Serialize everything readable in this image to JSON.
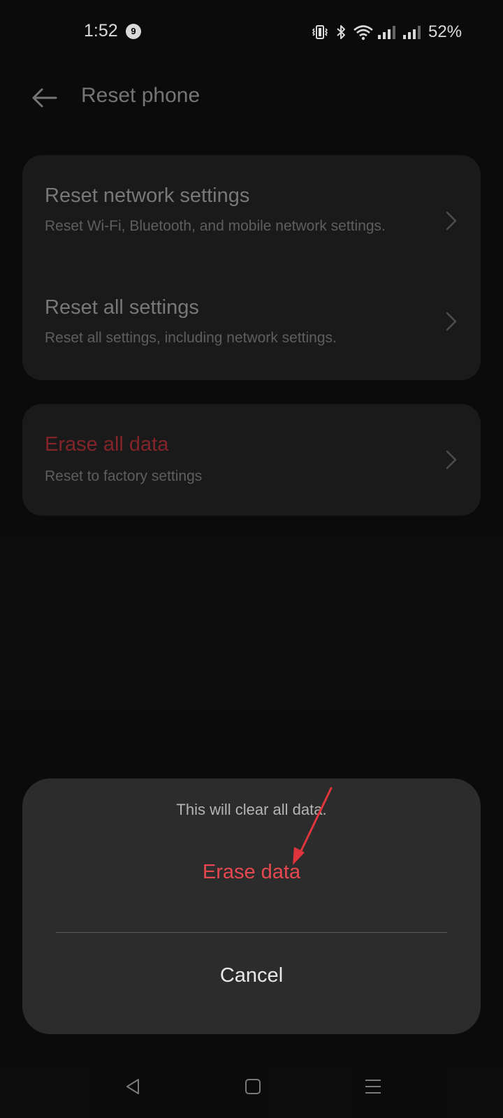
{
  "status_bar": {
    "time": "1:52",
    "notification_count": "9",
    "battery": "52%",
    "icons": [
      "vibrate-icon",
      "bluetooth-icon",
      "wifi-icon",
      "signal-1-icon",
      "signal-2-icon"
    ]
  },
  "header": {
    "title": "Reset phone",
    "back_icon": "arrow-left-icon"
  },
  "reset_group": {
    "items": [
      {
        "title": "Reset network settings",
        "desc": "Reset Wi-Fi, Bluetooth, and mobile network settings."
      },
      {
        "title": "Reset all settings",
        "desc": "Reset all settings, including network settings."
      }
    ]
  },
  "erase_group": {
    "title": "Erase all data",
    "desc": "Reset to factory settings"
  },
  "dialog": {
    "message": "This will clear all data.",
    "confirm_label": "Erase data",
    "cancel_label": "Cancel"
  },
  "colors": {
    "background": "#0e0e0e",
    "card": "#1f1f1f",
    "dialog": "#2c2c2c",
    "danger": "#e5484f",
    "annotation": "#e0353d"
  },
  "nav_bar": {
    "icons": [
      "back-triangle-icon",
      "home-square-icon",
      "menu-lines-icon"
    ]
  }
}
